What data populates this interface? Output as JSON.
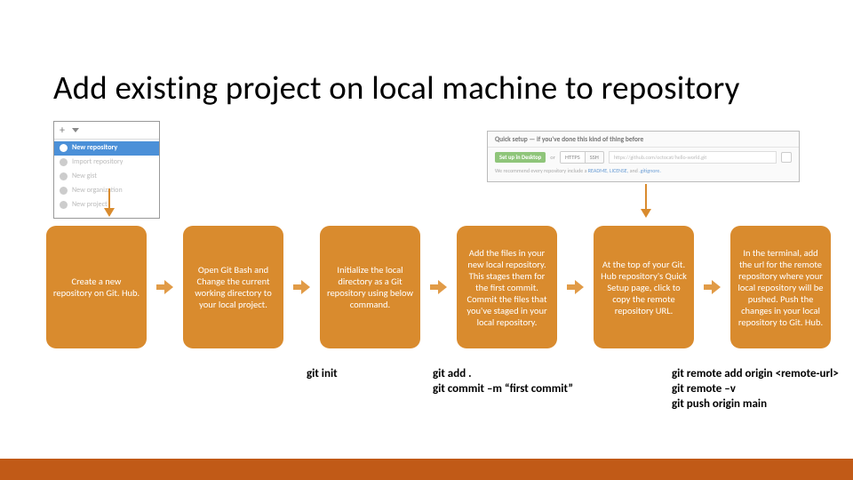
{
  "title": "Add existing project on local machine to repository",
  "menu": {
    "items": [
      "New repository",
      "Import repository",
      "New gist",
      "New organization",
      "New project"
    ]
  },
  "quicksetup": {
    "heading": "Quick setup — if you've done this kind of thing before",
    "button": "Set up in Desktop",
    "or": "or",
    "proto": [
      "HTTPS",
      "SSH"
    ],
    "url": "https://github.com/octocat/hello-world.git",
    "note_prefix": "We recommend every repository include a ",
    "note_colored": "README, LICENSE,",
    "note_mid": " and ",
    "note_colored2": ".gitignore."
  },
  "steps": [
    "Create a new repository on Git. Hub.",
    "Open Git Bash and Change the current working directory to your local project.",
    "Initialize the local directory as a Git repository using below command.",
    "Add the files in your new local repository. This stages them for the first commit. Commit the files that you've staged in your local repository.",
    "At the top of your Git. Hub repository's Quick Setup page, click  to copy the remote repository URL.",
    "In the terminal, add the url for the remote repository where your local repository will be pushed. Push the changes in your local repository to Git. Hub."
  ],
  "commands": {
    "c1": "git init",
    "c2_l1": "git add .",
    "c2_l2": "git commit –m “first commit”",
    "c3_l1": "git remote add origin <remote-url>",
    "c3_l2": "git remote –v",
    "c3_l3": "git push origin main"
  }
}
